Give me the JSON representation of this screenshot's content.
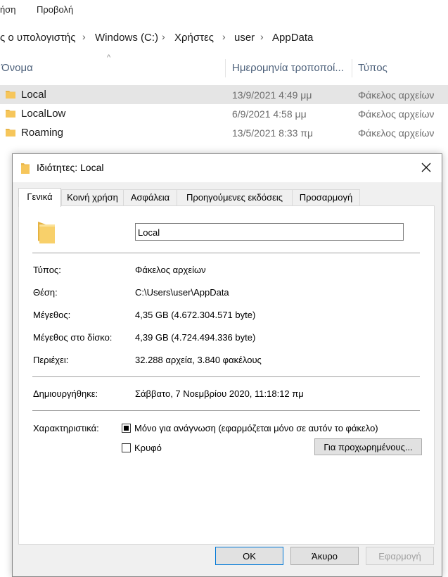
{
  "ribbon": {
    "tab1": "ήση",
    "tab2": "Προβολή"
  },
  "address": {
    "crumbs": [
      "ς ο υπολογιστής",
      "Windows (C:)",
      "Χρήστες",
      "user",
      "AppData"
    ]
  },
  "columns": {
    "name": "Όνομα",
    "date": "Ημερομηνία τροποποί...",
    "type": "Τύπος"
  },
  "files": [
    {
      "name": "Local",
      "date": "13/9/2021 4:49 μμ",
      "type": "Φάκελος αρχείων"
    },
    {
      "name": "LocalLow",
      "date": "6/9/2021 4:58 μμ",
      "type": "Φάκελος αρχείων"
    },
    {
      "name": "Roaming",
      "date": "13/5/2021 8:33 πμ",
      "type": "Φάκελος αρχείων"
    }
  ],
  "dialog": {
    "title": "Ιδιότητες: Local",
    "tabs": [
      "Γενικά",
      "Κοινή χρήση",
      "Ασφάλεια",
      "Προηγούμενες εκδόσεις",
      "Προσαρμογή"
    ],
    "active_tab": "Γενικά",
    "folder_name": "Local",
    "props": {
      "type_label": "Τύπος:",
      "type_value": "Φάκελος αρχείων",
      "location_label": "Θέση:",
      "location_value": "C:\\Users\\user\\AppData",
      "size_label": "Μέγεθος:",
      "size_value": "4,35 GB (4.672.304.571 byte)",
      "disk_label": "Μέγεθος στο δίσκο:",
      "disk_value": "4,39 GB (4.724.494.336 byte)",
      "contains_label": "Περιέχει:",
      "contains_value": "32.288 αρχεία, 3.840 φακέλους",
      "created_label": "Δημιουργήθηκε:",
      "created_value": "Σάββατο, 7 Νοεμβρίου 2020, 11:18:12 πμ",
      "attributes_label": "Χαρακτηριστικά:"
    },
    "readonly_label": "Μόνο για ανάγνωση (εφαρμόζεται μόνο σε αυτόν το φάκελο)",
    "readonly_state": "indeterminate",
    "hidden_label": "Κρυφό",
    "hidden_checked": false,
    "advanced_button": "Για προχωρημένους...",
    "ok_button": "OK",
    "cancel_button": "Άκυρο",
    "apply_button": "Εφαρμογή"
  },
  "colors": {
    "folder": "#f6c65b",
    "selection": "#e5e5e5",
    "accent": "#0078d7"
  },
  "icons": {
    "folder": "folder-icon",
    "close": "close-icon"
  }
}
